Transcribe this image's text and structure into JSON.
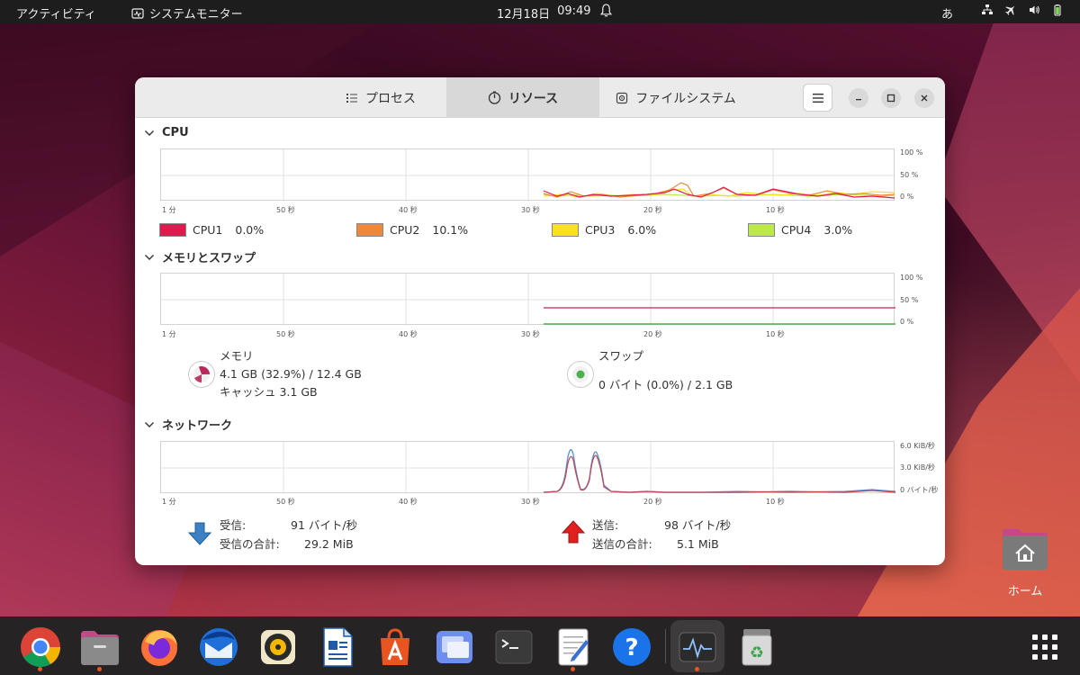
{
  "topbar": {
    "activities": "アクティビティ",
    "app_name": "システムモニター",
    "date": "12月18日",
    "time": "09:49",
    "ime": "あ"
  },
  "window": {
    "tabs": [
      {
        "label": "プロセス",
        "icon": "list-icon",
        "active": false
      },
      {
        "label": "リソース",
        "icon": "gauge-icon",
        "active": true
      },
      {
        "label": "ファイルシステム",
        "icon": "disk-icon",
        "active": false
      }
    ],
    "cpu": {
      "title": "CPU",
      "y_labels": [
        "100 %",
        "50 %",
        "0 %"
      ],
      "x_labels": [
        "1 分",
        "50 秒",
        "40 秒",
        "30 秒",
        "20 秒",
        "10 秒"
      ],
      "legend": [
        {
          "name": "CPU1",
          "value": "0.0%",
          "color": "#e0194f"
        },
        {
          "name": "CPU2",
          "value": "10.1%",
          "color": "#f0883a"
        },
        {
          "name": "CPU3",
          "value": "6.0%",
          "color": "#f8e21d"
        },
        {
          "name": "CPU4",
          "value": "3.0%",
          "color": "#bde84a"
        }
      ]
    },
    "memory": {
      "title": "メモリとスワップ",
      "y_labels": [
        "100 %",
        "50 %",
        "0 %"
      ],
      "x_labels": [
        "1 分",
        "50 秒",
        "40 秒",
        "30 秒",
        "20 秒",
        "10 秒"
      ],
      "mem_label": "メモリ",
      "mem_value": "4.1 GB (32.9%) / 12.4 GB",
      "cache": "キャッシュ 3.1 GB",
      "mem_color": "#b8285a",
      "swap_label": "スワップ",
      "swap_value": "0 バイト (0.0%) / 2.1 GB",
      "swap_color": "#4caf50"
    },
    "network": {
      "title": "ネットワーク",
      "y_labels": [
        "6.0 KiB/秒",
        "3.0 KiB/秒",
        "0 バイト/秒"
      ],
      "x_labels": [
        "1 分",
        "50 秒",
        "40 秒",
        "30 秒",
        "20 秒",
        "10 秒"
      ],
      "recv_label": "受信:",
      "recv_value": "91 バイト/秒",
      "recv_total_label": "受信の合計:",
      "recv_total_value": "29.2 MiB",
      "send_label": "送信:",
      "send_value": "98 バイト/秒",
      "send_total_label": "送信の合計:",
      "send_total_value": "5.1 MiB"
    }
  },
  "desktop": {
    "home_label": "ホーム"
  },
  "dock": {
    "items": [
      "chrome",
      "files",
      "firefox",
      "thunderbird",
      "rhythmbox",
      "libreoffice-writer",
      "app-center",
      "screenshot",
      "terminal",
      "text-editor",
      "help",
      "system-monitor",
      "trash"
    ]
  }
}
